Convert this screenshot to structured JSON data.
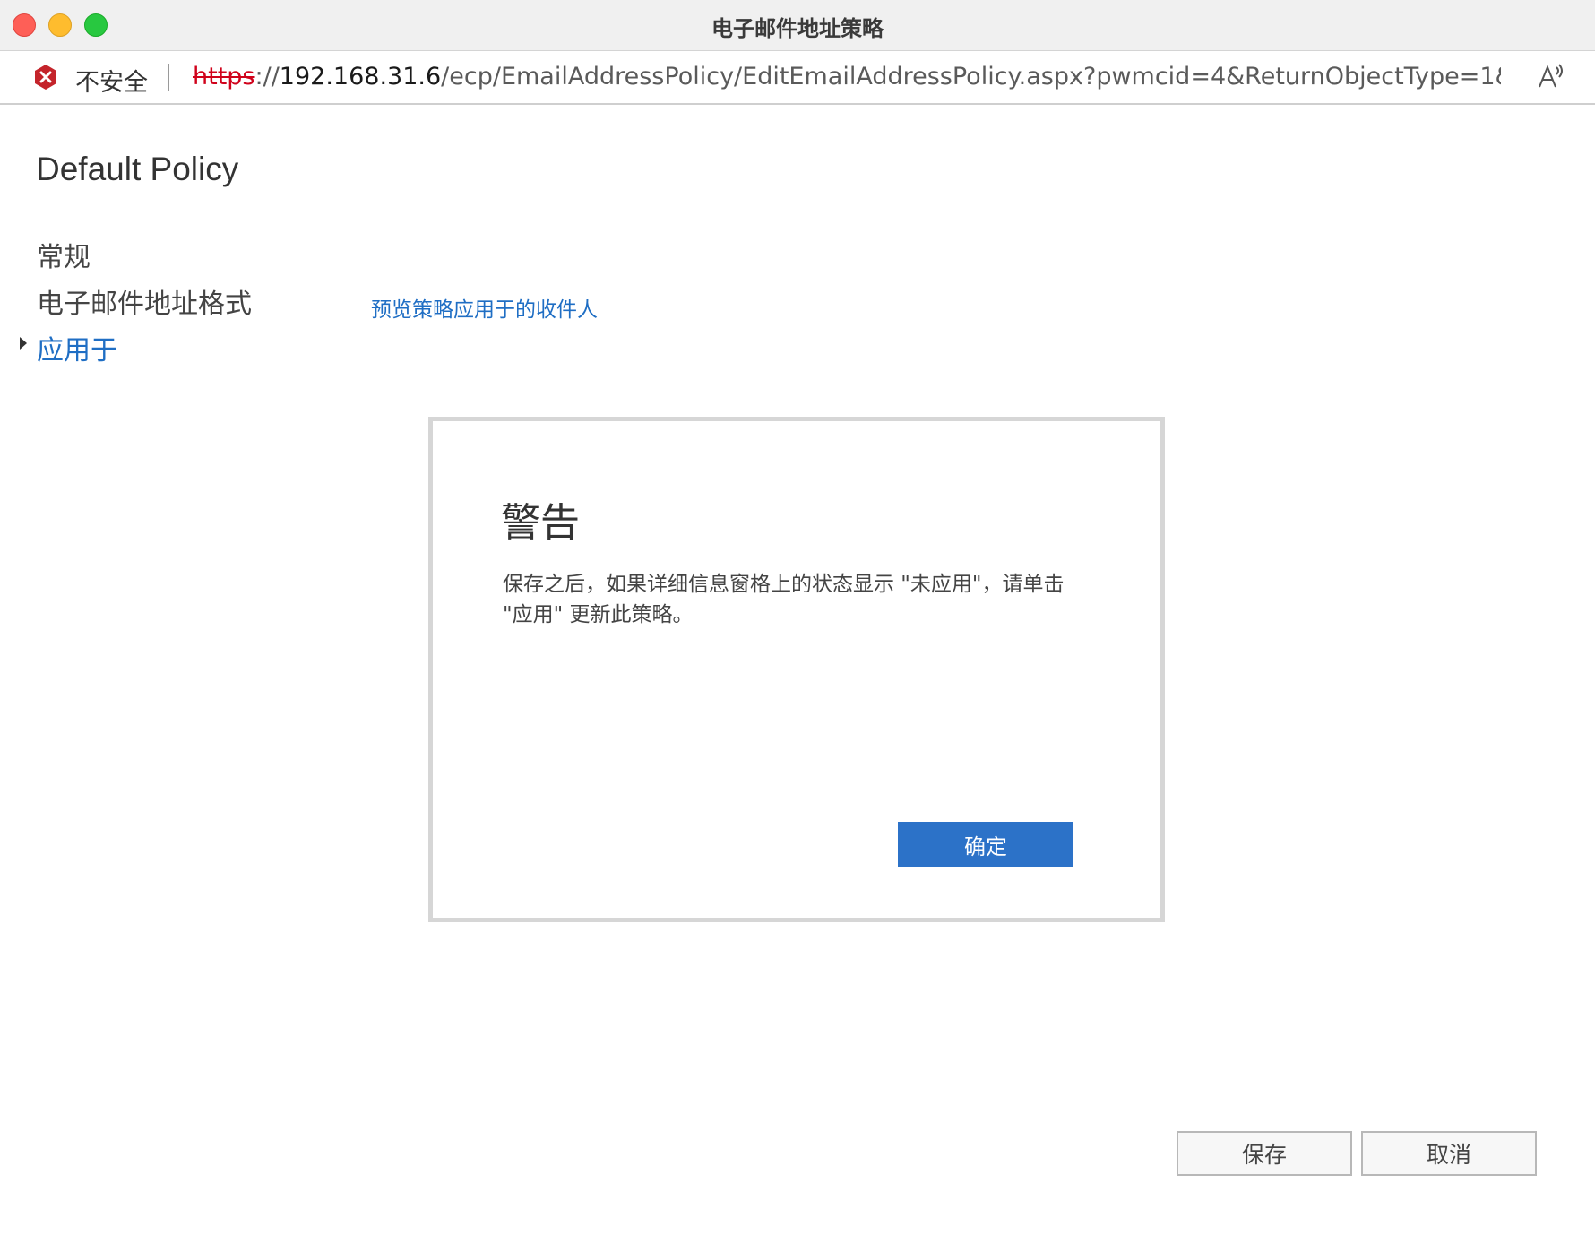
{
  "window": {
    "title": "电子邮件地址策略"
  },
  "address_bar": {
    "security_label": "不安全",
    "url_scheme": "https",
    "url_separator": "://",
    "url_host": "192.168.31.6",
    "url_rest": "/ecp/EmailAddressPolicy/EditEmailAddressPolicy.aspx?pwmcid=4&ReturnObjectType=1&…",
    "warning_icon": "x-circle-icon",
    "reader_icon": "read-aloud-icon"
  },
  "page": {
    "title": "Default Policy",
    "nav": [
      {
        "label": "常规",
        "active": false
      },
      {
        "label": "电子邮件地址格式",
        "active": false
      },
      {
        "label": "应用于",
        "active": true
      }
    ],
    "preview_link": "预览策略应用于的收件人"
  },
  "dialog": {
    "title": "警告",
    "message_line1": "保存之后，如果详细信息窗格上的状态显示 \"未应用\"，请单击",
    "message_line2": "\"应用\" 更新此策略。",
    "ok_label": "确定"
  },
  "footer": {
    "save_label": "保存",
    "cancel_label": "取消"
  },
  "colors": {
    "link": "#1f6ec4",
    "primary_button": "#2c72c8",
    "insecure": "#d0021b"
  }
}
